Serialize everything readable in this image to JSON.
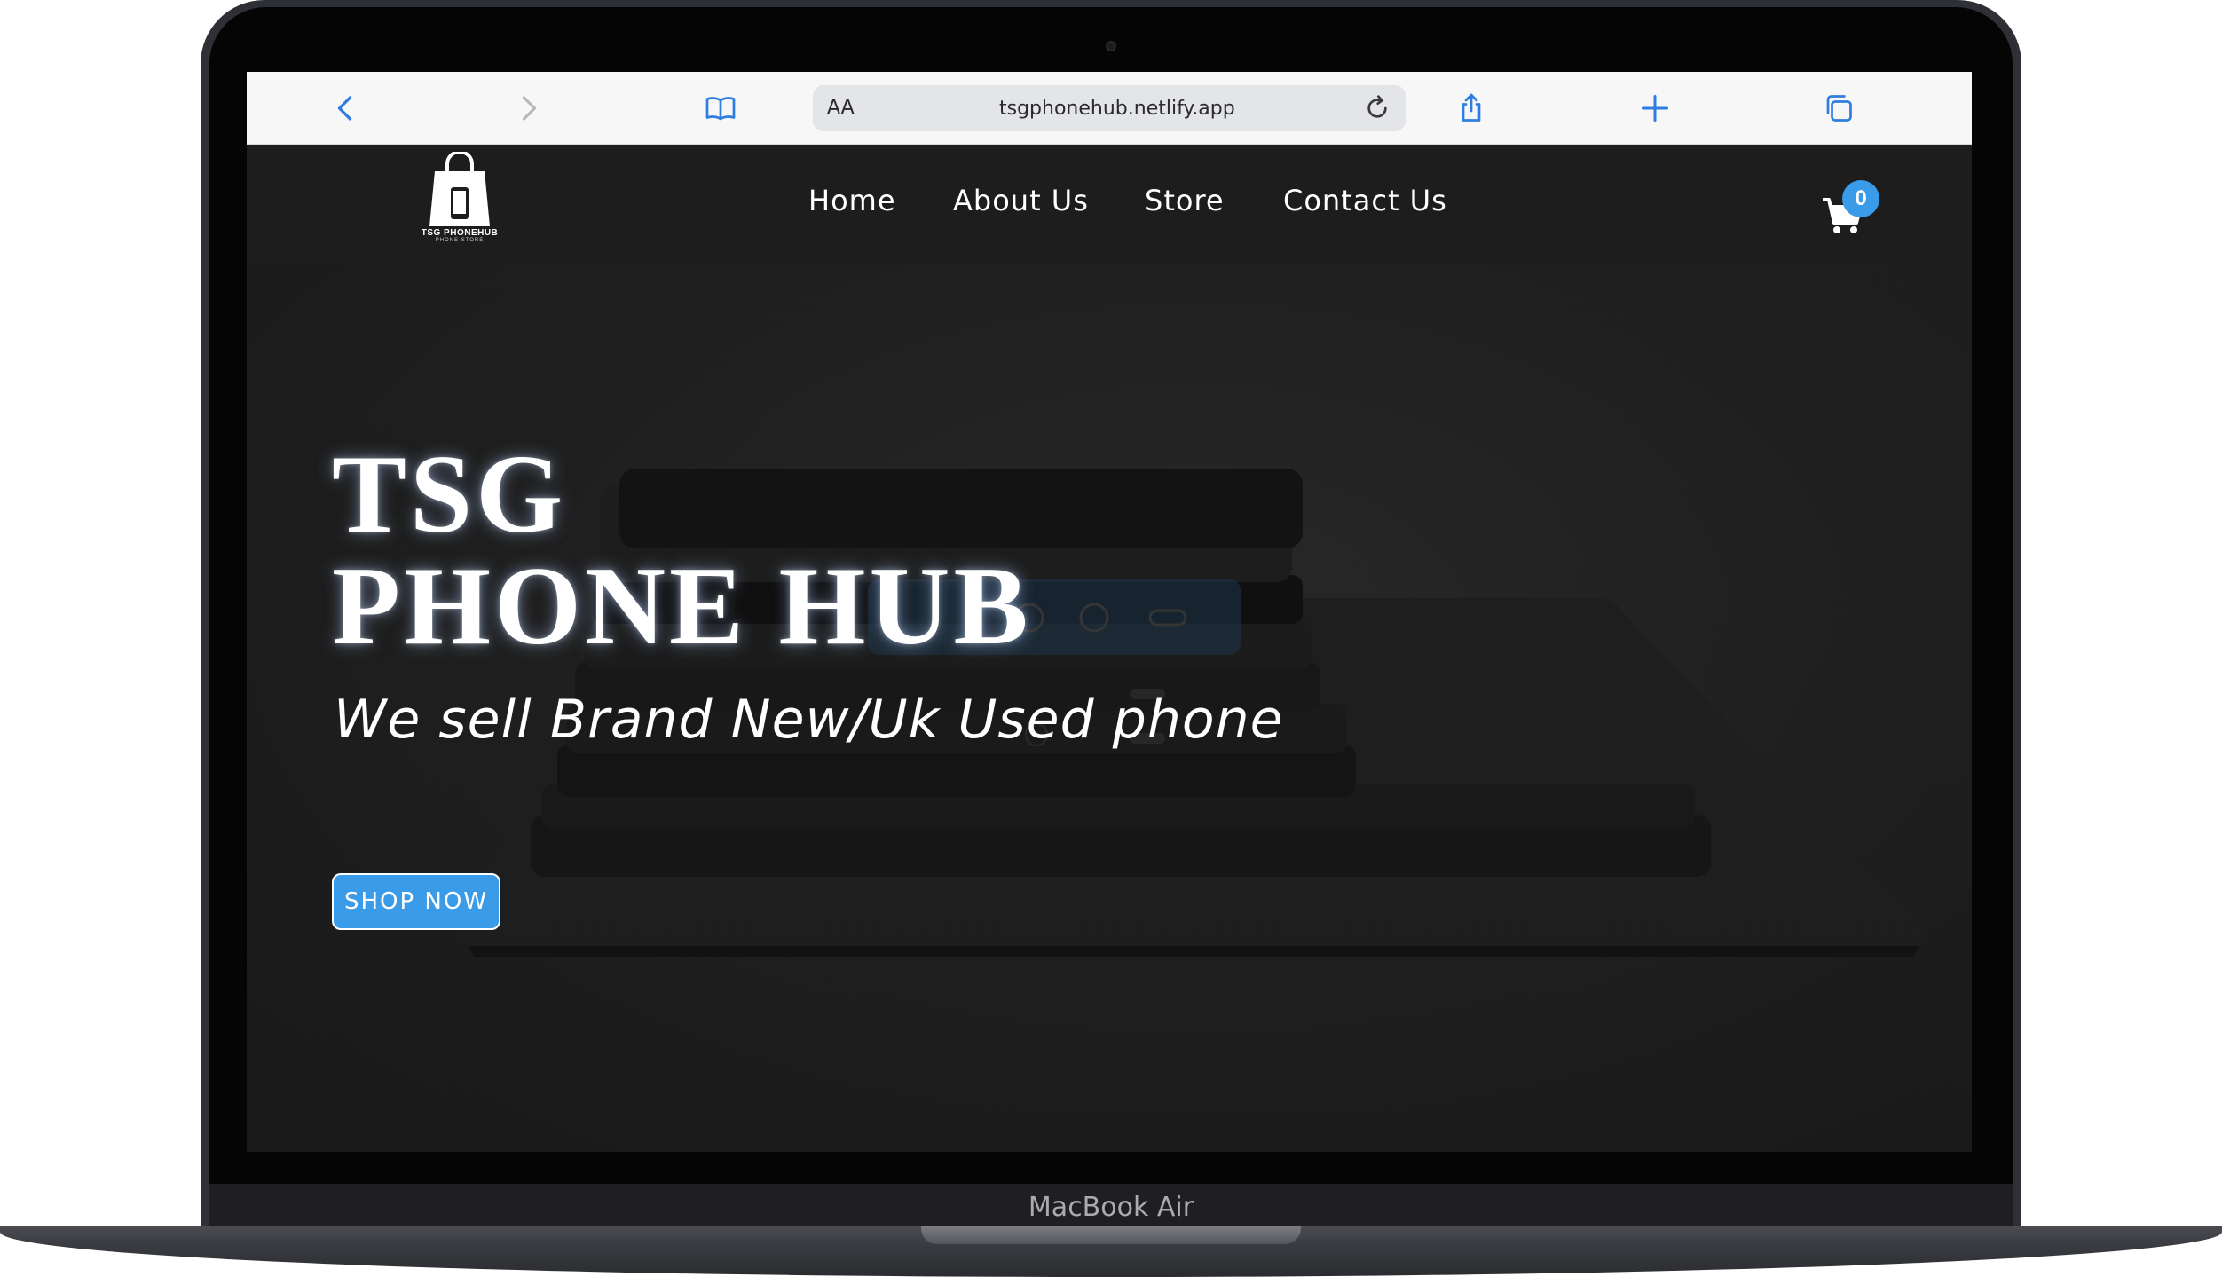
{
  "device": {
    "label": "MacBook Air"
  },
  "browser": {
    "aa_label": "AA",
    "url": "tsgphonehub.netlify.app",
    "icons": {
      "back": "chevron-left-icon",
      "forward": "chevron-right-icon",
      "bookmarks": "book-icon",
      "lock": "lock-icon",
      "reload": "reload-icon",
      "share": "share-icon",
      "new_tab": "plus-icon",
      "tabs": "tabs-icon"
    },
    "accent": "#2f7de1"
  },
  "site": {
    "logo": {
      "name": "TSG PHONEHUB",
      "tagline": "PHONE STORE"
    },
    "nav": [
      {
        "label": "Home"
      },
      {
        "label": "About Us"
      },
      {
        "label": "Store"
      },
      {
        "label": "Contact Us"
      }
    ],
    "cart": {
      "count": "0",
      "icon": "cart-icon"
    },
    "hero": {
      "title_line1": "TSG",
      "title_line2": "PHONE HUB",
      "subtitle": "We sell Brand New/Uk Used phone",
      "cta": "SHOP NOW"
    },
    "colors": {
      "accent": "#3a9be8",
      "nav_bg": "#1d1d1d",
      "hero_bg": "#202020"
    }
  }
}
